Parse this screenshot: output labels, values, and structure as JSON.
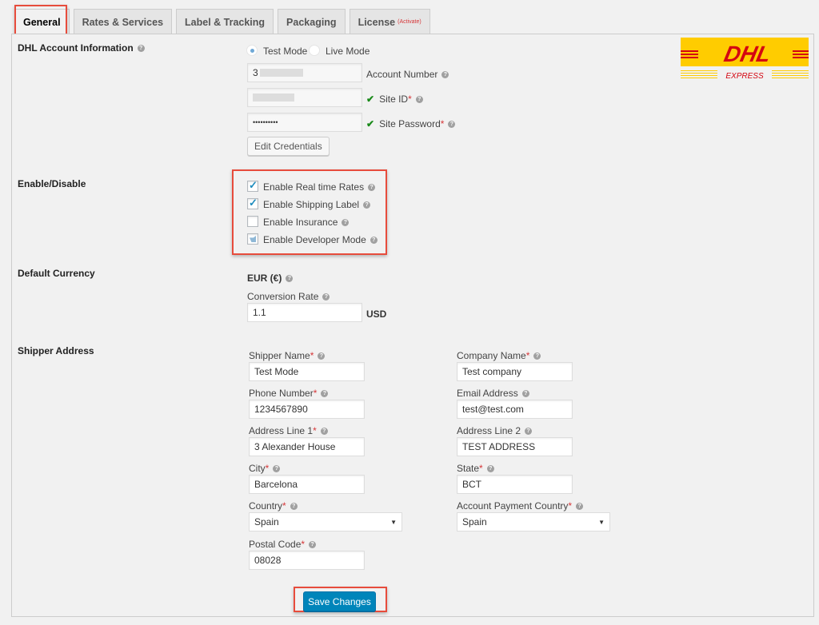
{
  "tabs": [
    {
      "label": "General",
      "active": true
    },
    {
      "label": "Rates & Services"
    },
    {
      "label": "Label & Tracking"
    },
    {
      "label": "Packaging"
    },
    {
      "label": "License",
      "badge": "(Activate)"
    }
  ],
  "account": {
    "section_label": "DHL Account Information",
    "mode_options": [
      "Test Mode",
      "Live Mode"
    ],
    "selected_mode": "Test Mode",
    "account_number_label": "Account Number",
    "account_number_value": "3",
    "site_id_label": "Site ID",
    "site_password_label": "Site Password",
    "site_password_value": "••••••••••",
    "edit_button": "Edit Credentials",
    "logo": {
      "text": "DHL",
      "subtext": "EXPRESS",
      "bg_color": "#ffcc00",
      "fg_color": "#d40511"
    }
  },
  "enable": {
    "section_label": "Enable/Disable",
    "options": [
      {
        "label": "Enable Real time Rates",
        "checked": true
      },
      {
        "label": "Enable Shipping Label",
        "checked": true
      },
      {
        "label": "Enable Insurance",
        "checked": false
      },
      {
        "label": "Enable Developer Mode",
        "checked": "indeterminate"
      }
    ]
  },
  "currency": {
    "section_label": "Default Currency",
    "currency": "EUR (€)",
    "conversion_label": "Conversion Rate",
    "conversion_value": "1.1",
    "conversion_unit": "USD"
  },
  "shipper": {
    "section_label": "Shipper Address",
    "shipper_name_label": "Shipper Name",
    "shipper_name": "Test Mode",
    "company_name_label": "Company Name",
    "company_name": "Test company",
    "phone_label": "Phone Number",
    "phone": "1234567890",
    "email_label": "Email Address",
    "email": "test@test.com",
    "address1_label": "Address Line 1",
    "address1": "3 Alexander House",
    "address2_label": "Address Line 2",
    "address2": "TEST ADDRESS",
    "city_label": "City",
    "city": "Barcelona",
    "state_label": "State",
    "state": "BCT",
    "country_label": "Country",
    "country": "Spain",
    "payment_country_label": "Account Payment Country",
    "payment_country": "Spain",
    "postal_label": "Postal Code",
    "postal": "08028"
  },
  "save_button": "Save Changes",
  "help_glyph": "?",
  "required_glyph": "*"
}
